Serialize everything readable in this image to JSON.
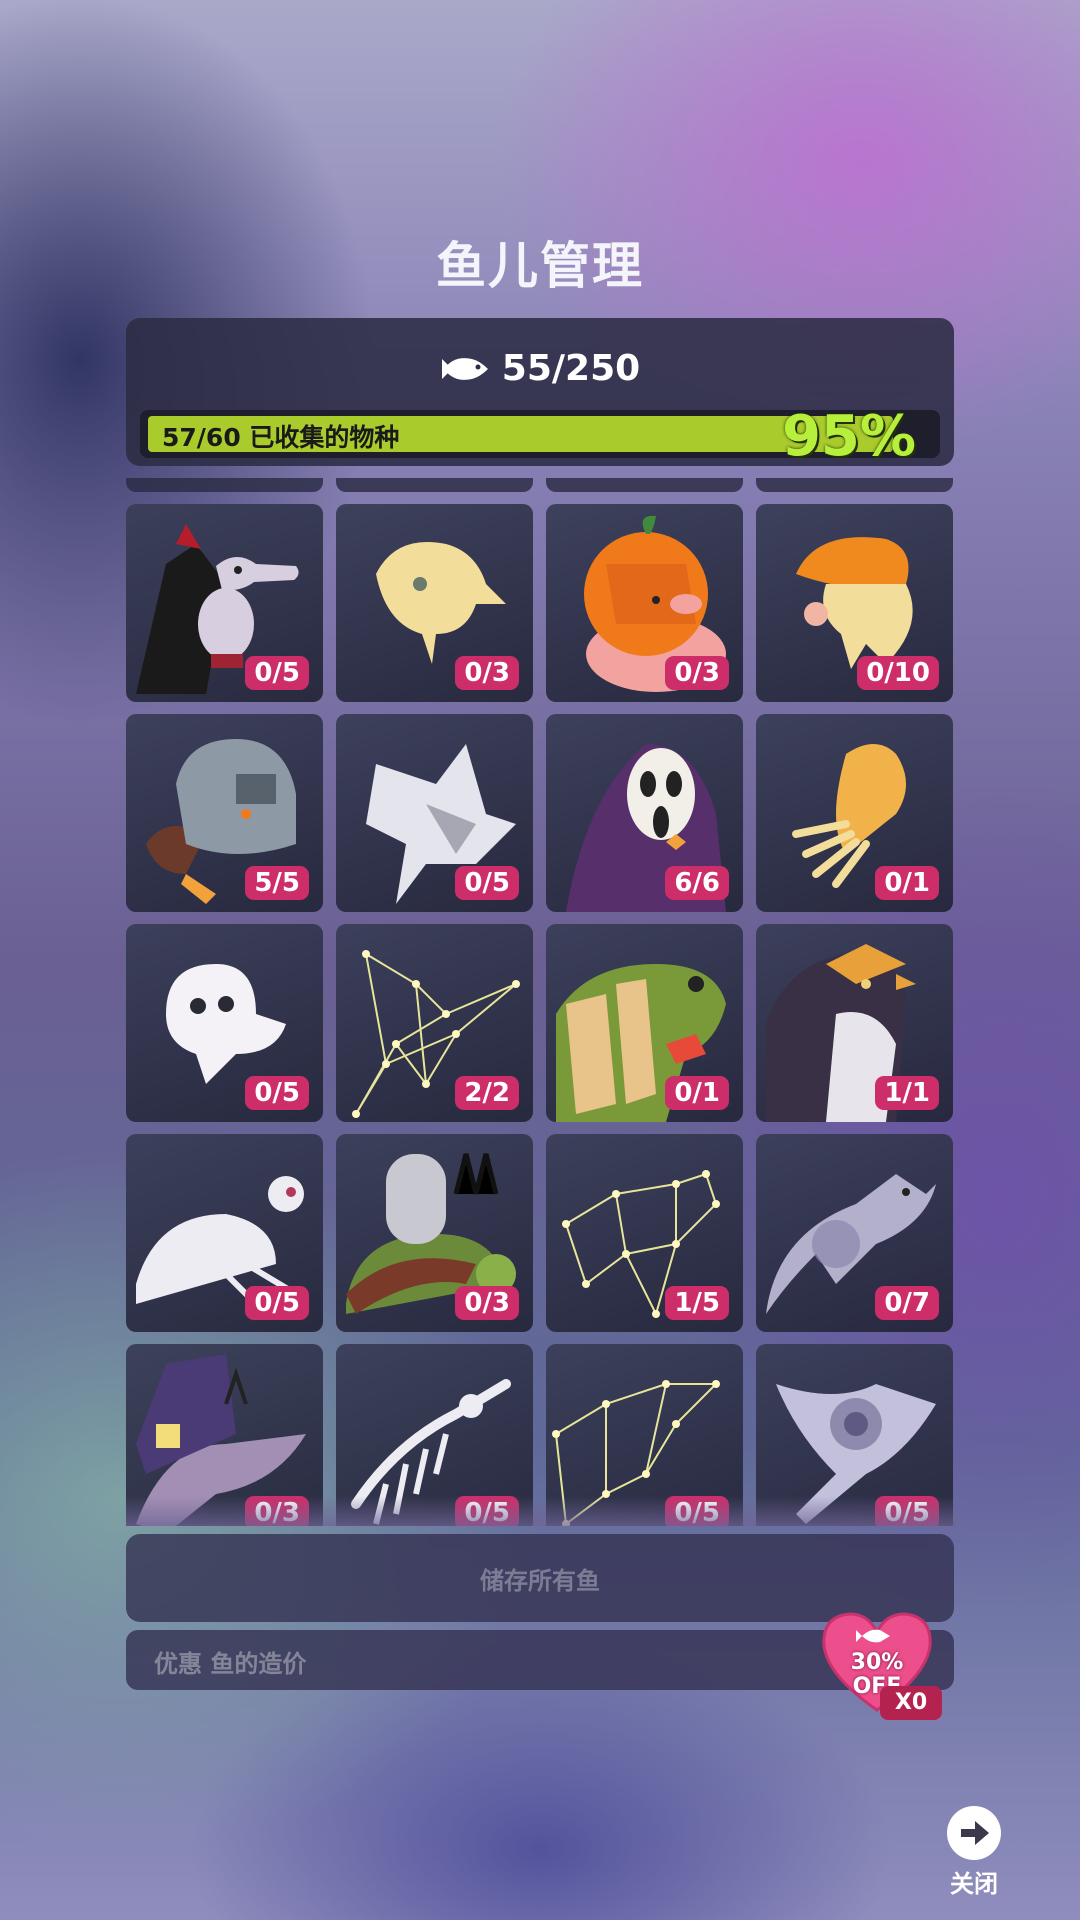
{
  "title": "鱼儿管理",
  "summary": {
    "fish_count": "55/250",
    "progress_label": "57/60 已收集的物种",
    "progress_percent": "95%",
    "progress_fraction": 0.95
  },
  "species": [
    {
      "icon": "vampire-seahorse-icon",
      "count": "0/5"
    },
    {
      "icon": "ghost-jellyfish-icon",
      "count": "0/3"
    },
    {
      "icon": "pumpkin-fish-icon",
      "count": "0/3"
    },
    {
      "icon": "mushroom-squid-icon",
      "count": "0/10"
    },
    {
      "icon": "knight-helmet-octopus-icon",
      "count": "5/5"
    },
    {
      "icon": "skeleton-fish-icon",
      "count": "0/5"
    },
    {
      "icon": "scream-mask-fish-icon",
      "count": "6/6"
    },
    {
      "icon": "lantern-jellyfish-icon",
      "count": "0/1"
    },
    {
      "icon": "ghost-fish-icon",
      "count": "0/5"
    },
    {
      "icon": "constellation-swordfish-icon",
      "count": "2/2"
    },
    {
      "icon": "mummy-fish-icon",
      "count": "0/1"
    },
    {
      "icon": "penguin-icon",
      "count": "1/1"
    },
    {
      "icon": "skeleton-turtle-icon",
      "count": "0/5"
    },
    {
      "icon": "graveyard-turtle-icon",
      "count": "0/3"
    },
    {
      "icon": "constellation-turtle-icon",
      "count": "1/5"
    },
    {
      "icon": "dolphin-icon",
      "count": "0/7"
    },
    {
      "icon": "haunted-house-dolphin-icon",
      "count": "0/3"
    },
    {
      "icon": "skeleton-swordfish-icon",
      "count": "0/5"
    },
    {
      "icon": "constellation-dolphin-icon",
      "count": "0/5"
    },
    {
      "icon": "manta-ray-icon",
      "count": "0/5"
    }
  ],
  "store_all_label": "储存所有鱼",
  "discount": {
    "label": "优惠 鱼的造价",
    "percent": "30%",
    "off": "OFF",
    "count": "X0"
  },
  "close_label": "关闭",
  "colors": {
    "badge": "#cd2e6a",
    "progress_fill": "#a9cb2c",
    "progress_text": "#b7f03c",
    "heart": "#ec4f8c"
  }
}
